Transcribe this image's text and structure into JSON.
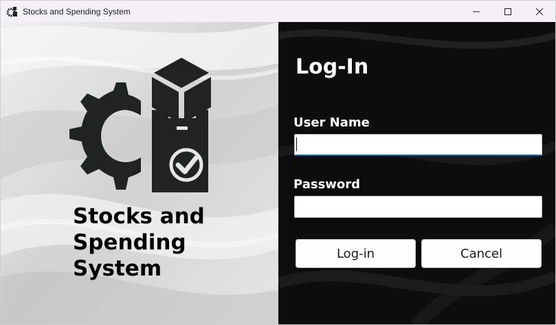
{
  "window": {
    "title": "Stocks and Spending System",
    "controls": [
      "minimize",
      "maximize",
      "close"
    ]
  },
  "left": {
    "logo_icon": "gear-box-clipboard-check-icon",
    "system_name_lines": [
      "Stocks and",
      "Spending",
      "System"
    ]
  },
  "login": {
    "title": "Log-In",
    "username_label": "User Name",
    "username_value": "",
    "password_label": "Password",
    "password_value": "",
    "login_button": "Log-in",
    "cancel_button": "Cancel"
  },
  "colors": {
    "accent": "#0a5fb8",
    "left_bg": "#d9d9d9",
    "right_bg": "#0d0d0d",
    "logo": "#1f2422"
  }
}
